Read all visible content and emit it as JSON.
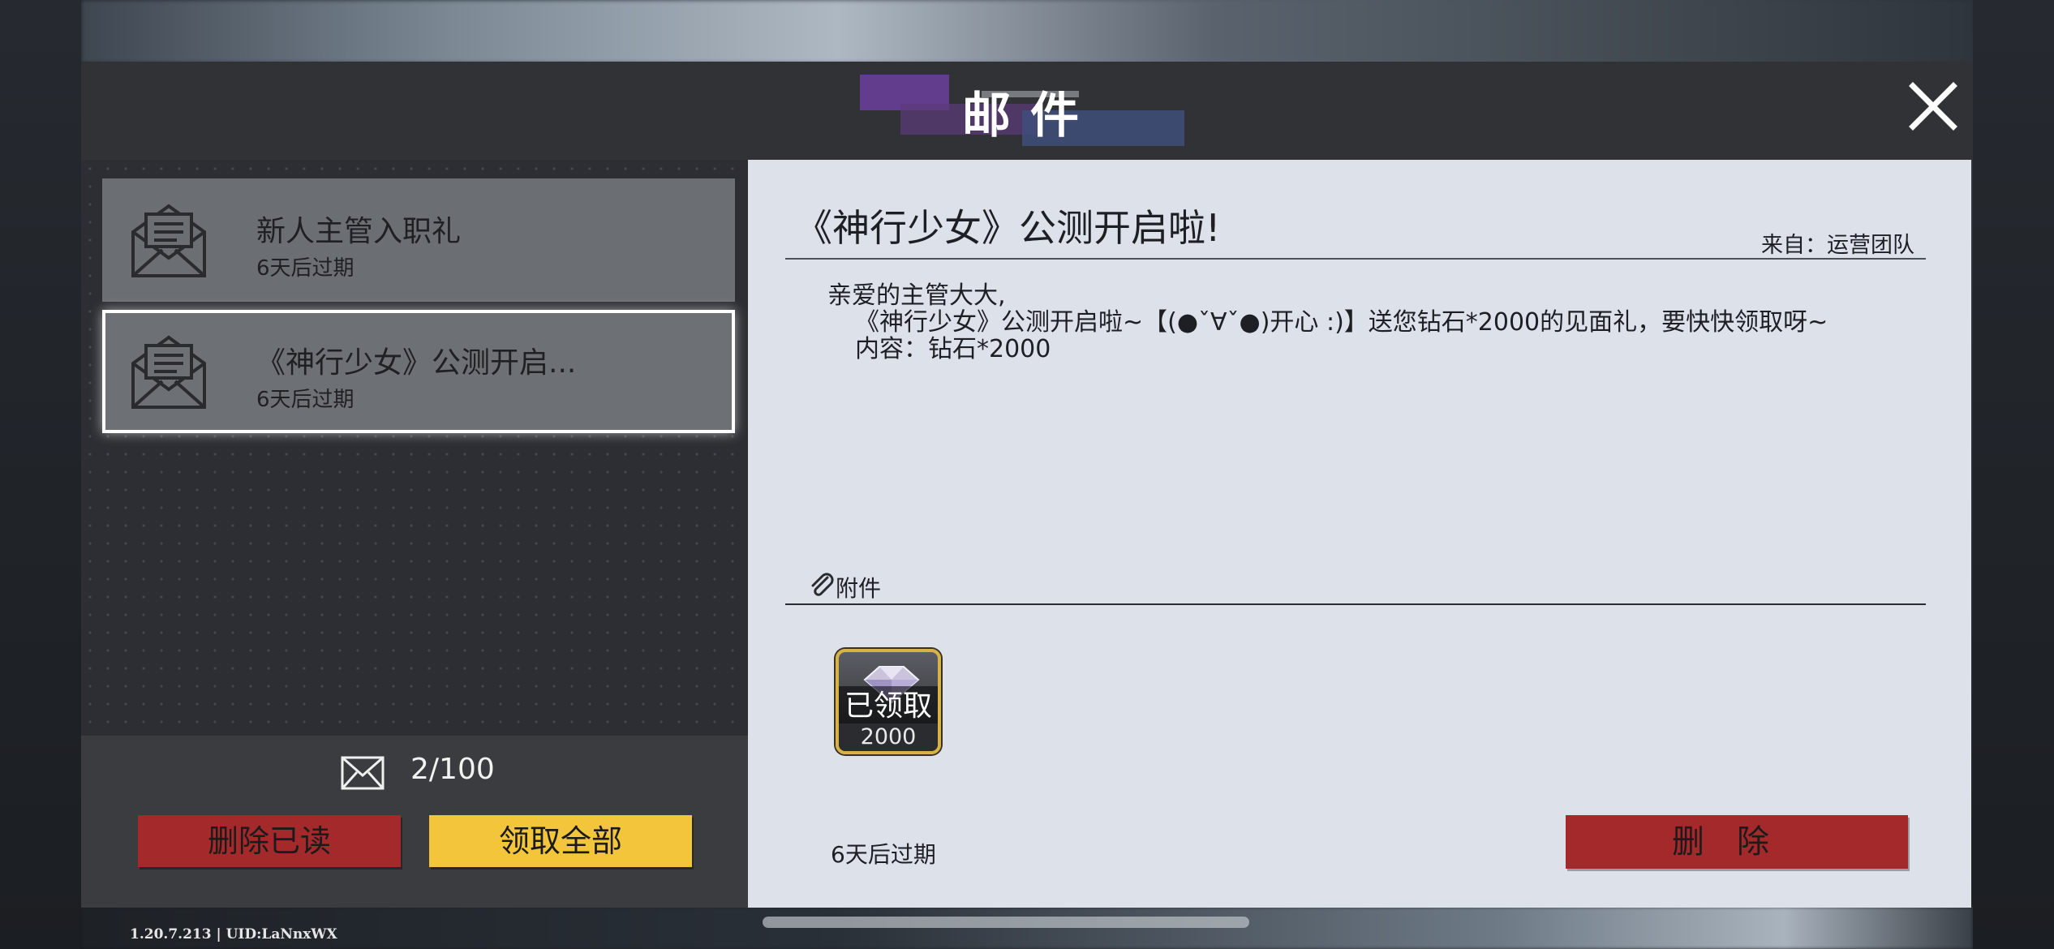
{
  "header": {
    "title": "邮件"
  },
  "mail_list": {
    "items": [
      {
        "subject": "新人主管入职礼",
        "expire": "6天后过期",
        "selected": false
      },
      {
        "subject": "《神行少女》公测开启...",
        "expire": "6天后过期",
        "selected": true
      }
    ],
    "count": "2/100",
    "delete_read_label": "删除已读",
    "claim_all_label": "领取全部"
  },
  "detail": {
    "title": "《神行少女》公测开启啦!",
    "sender": "来自：运营团队",
    "body": {
      "greeting": "亲爱的主管大大,",
      "line2": "《神行少女》公测开启啦~【(●ˇ∀ˇ●)开心 :)】送您钻石*2000的见面礼，要快快领取呀~",
      "line3": "内容：钻石*2000"
    },
    "attachment_label": "附件",
    "attachment": {
      "status": "已领取",
      "quantity": "2000",
      "icon": "diamond-icon"
    },
    "expire": "6天后过期",
    "delete_label": "删除"
  },
  "footer": {
    "version": "1.20.7.213 | UID:LaNnxWX"
  },
  "colors": {
    "header_bg": "#303236",
    "detail_bg": "#dde1ea",
    "danger": "#a4292b",
    "accent_yellow": "#f3c53a",
    "frame_gold": "#d7b247"
  }
}
